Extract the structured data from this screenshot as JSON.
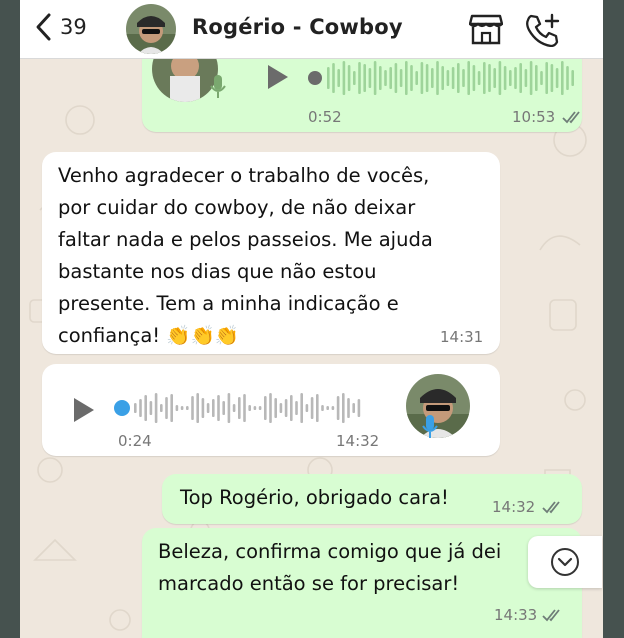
{
  "header": {
    "back_count": "39",
    "contact_name": "Rogério - Cowboy",
    "icons": [
      "back-chevron-icon",
      "store-icon",
      "add-call-icon"
    ]
  },
  "messages": [
    {
      "kind": "audio",
      "direction": "out",
      "duration": "0:52",
      "time": "10:53",
      "status": "read"
    },
    {
      "kind": "text",
      "direction": "in",
      "text": "Venho agradecer o trabalho de vocês,\npor cuidar do cowboy, de não deixar\nfaltar nada e pelos passeios. Me ajuda\nbastante nos dias que não estou\npresente. Tem a minha indicação e\nconfiança! 👏👏👏",
      "time": "14:31"
    },
    {
      "kind": "audio",
      "direction": "in",
      "duration": "0:24",
      "time": "14:32"
    },
    {
      "kind": "text",
      "direction": "out",
      "text": "Top Rogério, obrigado cara!",
      "time": "14:32",
      "status": "read"
    },
    {
      "kind": "text",
      "direction": "out",
      "text": "Beleza, confirma comigo que já dei\nmarcado então se for precisar!",
      "time": "14:33",
      "status": "read"
    }
  ],
  "colors": {
    "incoming_bubble": "#ffffff",
    "outgoing_bubble": "#d8fdd2",
    "chat_background": "#efe7dd",
    "read_ticks": "#6f7d78",
    "mic_icon": "#3aa0e6"
  }
}
